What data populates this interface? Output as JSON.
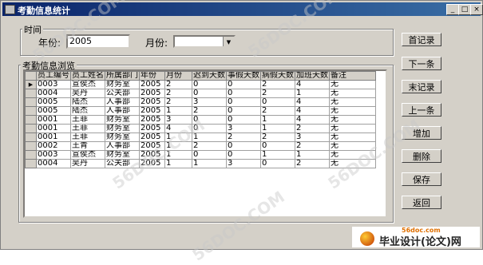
{
  "window": {
    "title": "考勤信息统计",
    "min": "_",
    "max": "□",
    "close": "×"
  },
  "time_group": {
    "label": "时间",
    "year_label": "年份:",
    "year_value": "2005",
    "month_label": "月份:",
    "month_value": ""
  },
  "browse_group": {
    "label": "考勤信息浏览"
  },
  "table": {
    "columns": [
      "员工编号",
      "员工姓名",
      "所属部门",
      "年份",
      "月份",
      "迟到天数",
      "事假天数",
      "病假天数",
      "加班天数",
      "备注"
    ],
    "rows": [
      [
        "0003",
        "宣侯杰",
        "财务室",
        "2005",
        "2",
        "0",
        "0",
        "2",
        "4",
        "无"
      ],
      [
        "0004",
        "吴丹",
        "公关部",
        "2005",
        "2",
        "0",
        "0",
        "2",
        "1",
        "无"
      ],
      [
        "0005",
        "陆杰",
        "人事部",
        "2005",
        "2",
        "3",
        "0",
        "0",
        "4",
        "无"
      ],
      [
        "0005",
        "陆杰",
        "人事部",
        "2005",
        "1",
        "2",
        "0",
        "2",
        "4",
        "无"
      ],
      [
        "0001",
        "王菲",
        "财务室",
        "2005",
        "3",
        "0",
        "0",
        "1",
        "4",
        "无"
      ],
      [
        "0001",
        "王菲",
        "财务室",
        "2005",
        "4",
        "0",
        "3",
        "1",
        "2",
        "无"
      ],
      [
        "0001",
        "王菲",
        "财务室",
        "2005",
        "1",
        "1",
        "2",
        "2",
        "3",
        "无"
      ],
      [
        "0002",
        "王青",
        "人事部",
        "2005",
        "1",
        "2",
        "0",
        "0",
        "2",
        "无"
      ],
      [
        "0003",
        "宣侯杰",
        "财务室",
        "2005",
        "1",
        "0",
        "0",
        "1",
        "1",
        "无"
      ],
      [
        "0004",
        "吴丹",
        "公关部",
        "2005",
        "1",
        "1",
        "3",
        "0",
        "2",
        "无"
      ]
    ],
    "selected_marker": "▶"
  },
  "buttons": {
    "first": "首记录",
    "next": "下一条",
    "last": "末记录",
    "prev": "上一条",
    "add": "增加",
    "delete": "删除",
    "save": "保存",
    "back": "返回"
  },
  "logo": {
    "site": "56doc.com",
    "brand": "毕业设计(论文)网"
  },
  "watermark": "56DOC.COM"
}
